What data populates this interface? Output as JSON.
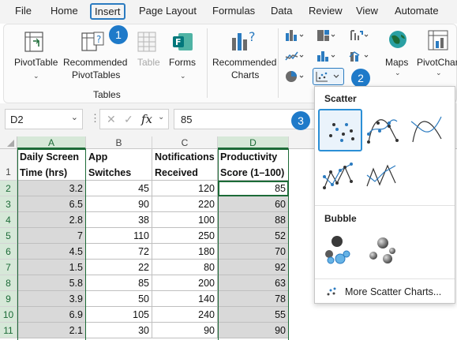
{
  "menu": {
    "items": [
      "File",
      "Home",
      "Insert",
      "Page Layout",
      "Formulas",
      "Data",
      "Review",
      "View",
      "Automate"
    ]
  },
  "ribbon": {
    "pivottable": "PivotTable",
    "recommended_pivot_1": "Recommended",
    "recommended_pivot_2": "PivotTables",
    "table": "Table",
    "forms": "Forms",
    "group_tables": "Tables",
    "recommended_charts_1": "Recommended",
    "recommended_charts_2": "Charts",
    "maps": "Maps",
    "pivotchart": "PivotChar"
  },
  "badges": {
    "one": "1",
    "two": "2",
    "three": "3"
  },
  "formula_bar": {
    "name_box": "D2",
    "fx": "fx",
    "value": "85"
  },
  "columns": [
    "A",
    "B",
    "C",
    "D"
  ],
  "header_row": {
    "row_num": "1",
    "a": "Daily Screen Time (hrs)",
    "b": "App Switches per",
    "c": "Notifications Received",
    "d": "Productivity Score (1–100)"
  },
  "rows": [
    {
      "n": "2",
      "a": "3.2",
      "b": "45",
      "c": "120",
      "d": "85"
    },
    {
      "n": "3",
      "a": "6.5",
      "b": "90",
      "c": "220",
      "d": "60"
    },
    {
      "n": "4",
      "a": "2.8",
      "b": "38",
      "c": "100",
      "d": "88"
    },
    {
      "n": "5",
      "a": "7",
      "b": "110",
      "c": "250",
      "d": "52"
    },
    {
      "n": "6",
      "a": "4.5",
      "b": "72",
      "c": "180",
      "d": "70"
    },
    {
      "n": "7",
      "a": "1.5",
      "b": "22",
      "c": "80",
      "d": "92"
    },
    {
      "n": "8",
      "a": "5.8",
      "b": "85",
      "c": "200",
      "d": "63"
    },
    {
      "n": "9",
      "a": "3.9",
      "b": "50",
      "c": "140",
      "d": "78"
    },
    {
      "n": "10",
      "a": "6.9",
      "b": "105",
      "c": "240",
      "d": "55"
    },
    {
      "n": "11",
      "a": "2.1",
      "b": "30",
      "c": "90",
      "d": "90"
    }
  ],
  "dropdown": {
    "scatter_title": "Scatter",
    "bubble_title": "Bubble",
    "more": "More Scatter Charts..."
  },
  "colors": {
    "accent": "#2b7bc0",
    "badge": "#1f7ac9",
    "selected_header": "#1c6b37",
    "gray_fill": "#d9d9d9"
  }
}
